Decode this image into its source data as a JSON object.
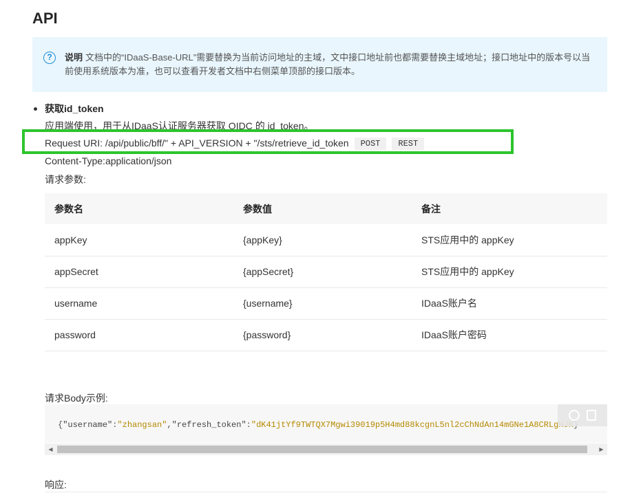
{
  "page": {
    "title": "API"
  },
  "note": {
    "icon": "question-circle-icon",
    "label": "说明",
    "text": "文档中的“IDaaS-Base-URL”需要替换为当前访问地址的主域，文中接口地址前也都需要替换主域地址；接口地址中的版本号以当前使用系统版本为准，也可以查看开发者文档中右侧菜单顶部的接口版本。"
  },
  "section": {
    "heading": "获取id_token",
    "description": "应用端使用，用于从IDaaS认证服务器获取 OIDC 的 id_token。",
    "request_uri": "Request URI: /api/public/bff/\" + API_VERSION + \"/sts/retrieve_id_token",
    "method_tag": "POST",
    "type_tag": "REST",
    "content_type": "Content-Type:application/json",
    "params_label": "请求参数:"
  },
  "params_table": {
    "headers": [
      "参数名",
      "参数值",
      "备注"
    ],
    "rows": [
      [
        "appKey",
        "{appKey}",
        "STS应用中的 appKey"
      ],
      [
        "appSecret",
        "{appSecret}",
        "STS应用中的 appKey"
      ],
      [
        "username",
        "{username}",
        "IDaaS账户名"
      ],
      [
        "password",
        "{password}",
        "IDaaS账户密码"
      ]
    ]
  },
  "body_example": {
    "label": "请求Body示例:",
    "open": "{",
    "k1": "\"username\"",
    "colon1": ":",
    "v1": "\"zhangsan\"",
    "comma": ",",
    "k2": "\"refresh_token\"",
    "colon2": ":",
    "v2": "\"dK41jtYf9TWTQX7Mgwi39019p5H4md88kcgnL5nl2cChNdAn14mGNe1A8CRLgHJK",
    "close": "}"
  },
  "response": {
    "label": "响应:"
  },
  "colors": {
    "highlight_border": "#2ec42e",
    "note_bg": "#e9f6fd",
    "note_icon": "#1e8fd6",
    "code_string": "#b58900"
  }
}
